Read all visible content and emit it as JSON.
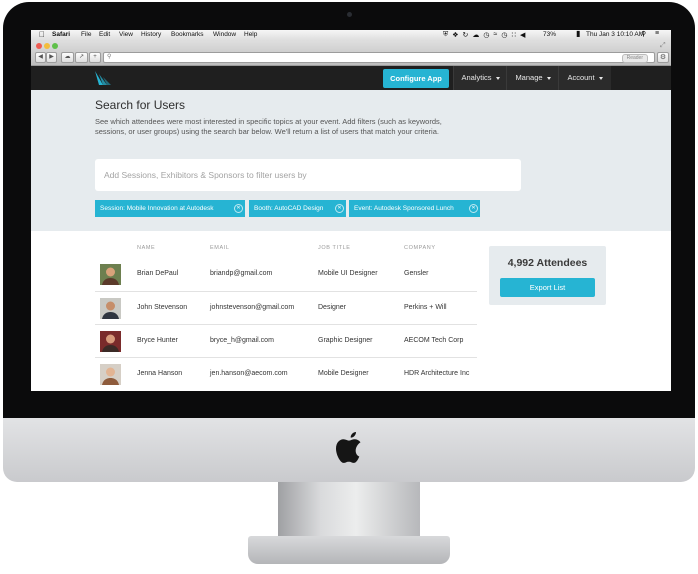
{
  "menubar": {
    "app_name": "Safari",
    "menus": [
      "File",
      "Edit",
      "View",
      "History",
      "Bookmarks",
      "Window",
      "Help"
    ],
    "battery": "73%",
    "datetime": "Thu Jan 3  10:10 AM"
  },
  "browser": {
    "reader_label": "Reader"
  },
  "nav": {
    "configure_label": "Configure App",
    "items": [
      {
        "label": "Analytics"
      },
      {
        "label": "Manage"
      },
      {
        "label": "Account"
      }
    ]
  },
  "search": {
    "title": "Search for Users",
    "description": "See which attendees were most interested in specific topics at your event. Add filters (such as keywords, sessions, or user groups) using the search bar below. We'll return a list of users that match your criteria.",
    "placeholder": "Add Sessions, Exhibitors & Sponsors to filter users by",
    "filters": [
      {
        "label": "Session: Mobile Innovation at Autodesk"
      },
      {
        "label": "Booth: AutoCAD Design"
      },
      {
        "label": "Event: Autodesk Sponsored Lunch"
      }
    ]
  },
  "table": {
    "headers": [
      "NAME",
      "EMAIL",
      "JOB TITLE",
      "COMPANY"
    ],
    "rows": [
      {
        "name": "Brian DePaul",
        "email": "briandp@gmail.com",
        "job": "Mobile UI Designer",
        "company": "Gensler"
      },
      {
        "name": "John Stevenson",
        "email": "johnstevenson@gmail.com",
        "job": "Designer",
        "company": "Perkins + Will"
      },
      {
        "name": "Bryce Hunter",
        "email": "bryce_h@gmail.com",
        "job": "Graphic Designer",
        "company": "AECOM Tech Corp"
      },
      {
        "name": "Jenna Hanson",
        "email": "jen.hanson@aecom.com",
        "job": "Mobile Designer",
        "company": "HDR Architecture Inc"
      }
    ]
  },
  "attendees": {
    "count_label": "4,992 Attendees",
    "export_label": "Export List"
  },
  "colors": {
    "accent": "#26b4d3",
    "navbar": "#1f1f1f",
    "search_bg": "#e6ebee"
  }
}
